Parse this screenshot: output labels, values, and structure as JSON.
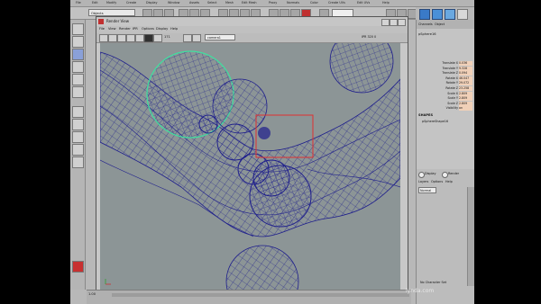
{
  "main_menu": [
    "File",
    "Edit",
    "Modify",
    "Create",
    "Display",
    "Window",
    "Assets",
    "Select",
    "Mesh",
    "Edit Mesh",
    "Proxy",
    "Normals",
    "Color",
    "Create UVs",
    "Edit UVs",
    "Help"
  ],
  "mode_select": "Objects",
  "render_view": {
    "title": "Render View",
    "menu": [
      "File",
      "View",
      "Render",
      "IPR",
      "Options",
      "Display",
      "Help"
    ],
    "toolbar_field": "camera1",
    "toolbar_value": "171",
    "ipr_label": "IPR 320 0",
    "status": "size: 960 x 540  zoom: 0.367"
  },
  "channel_box": {
    "tabs": [
      "Channels",
      "Object"
    ],
    "object_name": "pSphere16",
    "attributes": [
      {
        "name": "Translate X",
        "value": "0.036"
      },
      {
        "name": "Translate Y",
        "value": "9.328"
      },
      {
        "name": "Translate Z",
        "value": "0.094"
      },
      {
        "name": "Rotate X",
        "value": "46.047"
      },
      {
        "name": "Rotate Y",
        "value": "29.072"
      },
      {
        "name": "Rotate Z",
        "value": "23.258"
      },
      {
        "name": "Scale X",
        "value": "2.809"
      },
      {
        "name": "Scale Y",
        "value": "2.809"
      },
      {
        "name": "Scale Z",
        "value": "2.809"
      },
      {
        "name": "Visibility",
        "value": "on"
      }
    ],
    "shapes_header": "SHAPES",
    "shape_name": "pSphereShape16"
  },
  "layer_editor": {
    "display_label": "Display",
    "render_label": "Render",
    "menu": [
      "Layers",
      "Options",
      "Help"
    ],
    "mode_value": "Normal"
  },
  "time_slider": {
    "start": "1.00",
    "character_set": "No Character Set"
  },
  "watermark": "lynda.com",
  "colors": {
    "wireframe": "#1e1e8c",
    "selected": "#40e0a0",
    "viewport": "#8c9596",
    "marquee": "#e03030"
  }
}
